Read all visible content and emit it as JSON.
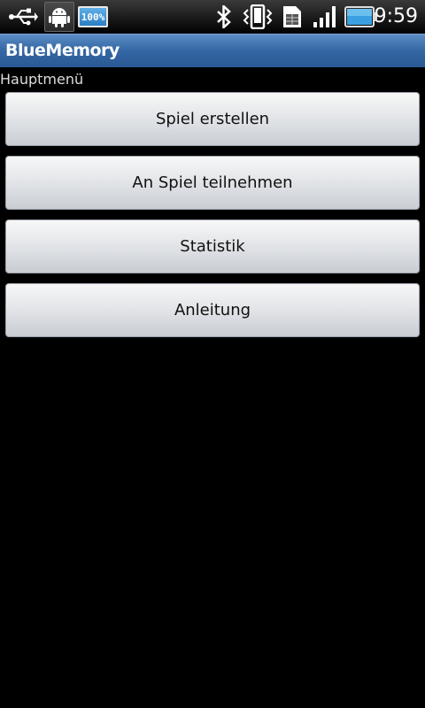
{
  "status_bar": {
    "battery_notification_text": "100%",
    "time": "9:59",
    "icons": [
      "usb-icon",
      "android-debug-icon",
      "battery-notification-icon",
      "bluetooth-icon",
      "vibrate-icon",
      "sim-icon",
      "signal-icon",
      "battery-icon"
    ]
  },
  "app": {
    "title": "BlueMemory"
  },
  "main": {
    "section_header": "Hauptmenü",
    "buttons": [
      {
        "label": "Spiel erstellen"
      },
      {
        "label": "An Spiel teilnehmen"
      },
      {
        "label": "Statistik"
      },
      {
        "label": "Anleitung"
      }
    ]
  },
  "colors": {
    "title_bar": "#3366a3",
    "background": "#000000",
    "button_face": "#e6e8eb"
  }
}
